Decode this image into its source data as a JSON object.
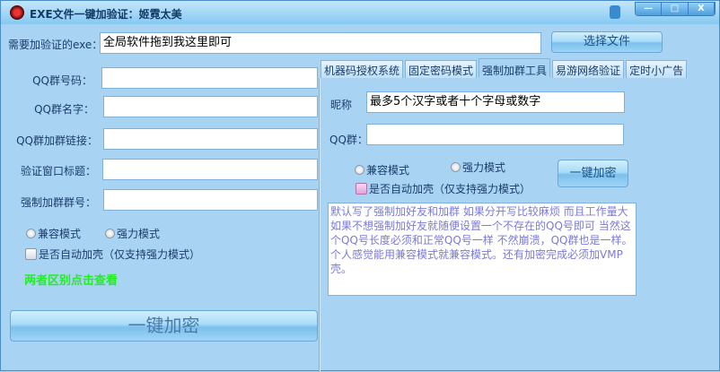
{
  "window": {
    "title": "EXE文件一键加验证：姬霓太美",
    "minimize": "—",
    "maximize": "□",
    "close": "X"
  },
  "exe": {
    "label": "需要加验证的exe：",
    "value": "全局软件拖到我这里即可",
    "choose_button": "选择文件"
  },
  "left": {
    "fields": [
      {
        "label": "QQ群号码：",
        "value": ""
      },
      {
        "label": "QQ群名字：",
        "value": ""
      },
      {
        "label": "QQ群加群链接：",
        "value": ""
      },
      {
        "label": "验证窗口标题：",
        "value": ""
      },
      {
        "label": "强制加群群号：",
        "value": ""
      }
    ],
    "radio_compat": "兼容模式",
    "radio_strong": "强力模式",
    "auto_shell": "是否自动加壳（仅支持强力模式）",
    "diff_link": "两者区别点击查看",
    "encrypt_button": "一键加密"
  },
  "tabs": [
    {
      "label": "机器码授权系统"
    },
    {
      "label": "固定密码模式"
    },
    {
      "label": "强制加群工具",
      "active": true
    },
    {
      "label": "易游网络验证"
    },
    {
      "label": "定时小广告"
    }
  ],
  "right": {
    "nickname_label": "昵称",
    "nickname_value": "最多5个汉字或者十个字母或数字",
    "qq_group_label": "QQ群：",
    "qq_group_value": "",
    "radio_compat": "兼容模式",
    "radio_strong": "强力模式",
    "auto_shell": "是否自动加壳（仅支持强力模式）",
    "encrypt_button": "一键加密",
    "notes": "默认写了强制加好友和加群 如果分开写比较麻烦 而且工作量大 如果不想强制加好友就随便设置一个不存在的QQ号即可 当然这个QQ号长度必须和正常QQ号一样 不然崩溃，QQ群也是一样。个人感觉能用兼容模式就兼容模式。还有加密完成必须加VMP壳。"
  },
  "colors": {
    "bg": "#a9d3f3",
    "link_green": "#22ee22",
    "notes_text": "#7a7ad8"
  }
}
